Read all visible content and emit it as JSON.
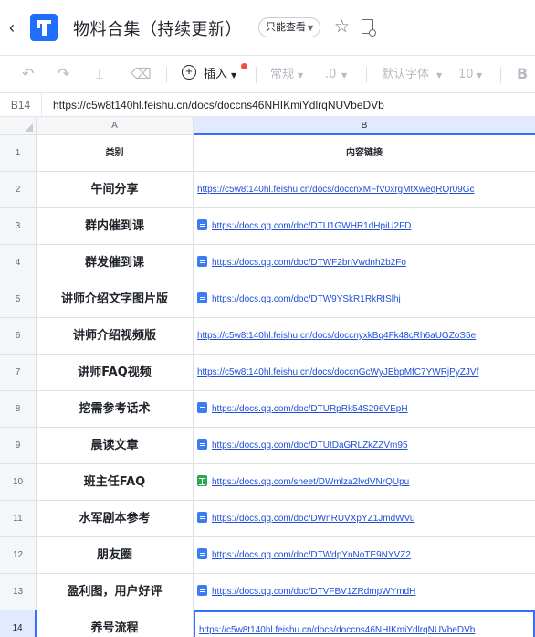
{
  "app": {
    "doc_title": "物料合集（持续更新）",
    "permission_label": "只能查看",
    "back_glyph": "‹",
    "star_glyph": "☆"
  },
  "toolbar": {
    "undo": "↶",
    "redo": "↷",
    "format_painter": "⌶",
    "clear_format": "⌫",
    "insert_label": "插入",
    "number_format": "常规",
    "decimal": ".0",
    "font_family": "默认字体",
    "font_size": "10",
    "bold": "B"
  },
  "formula_bar": {
    "cell_ref": "B14",
    "value": "https://c5w8t140hl.feishu.cn/docs/doccns46NHIKmiYdlrqNUVbeDVb"
  },
  "columns": [
    "A",
    "B"
  ],
  "rows": [
    {
      "num": "1",
      "category": "类别",
      "link": "内容链接",
      "icon": "none",
      "header": true
    },
    {
      "num": "2",
      "category": "午间分享",
      "link": "https://c5w8t140hl.feishu.cn/docs/doccnxMFfV0xrgMtXweqRQr09Gc",
      "icon": "none"
    },
    {
      "num": "3",
      "category": "群内催到课",
      "link": "https://docs.qq.com/doc/DTU1GWHR1dHpiU2FD",
      "icon": "doc"
    },
    {
      "num": "4",
      "category": "群发催到课",
      "link": "https://docs.qq.com/doc/DTWF2bnVwdnh2b2Fo",
      "icon": "doc"
    },
    {
      "num": "5",
      "category": "讲师介绍文字图片版",
      "link": "https://docs.qq.com/doc/DTW9YSkR1RkRISlhj",
      "icon": "doc"
    },
    {
      "num": "6",
      "category": "讲师介绍视频版",
      "link": "https://c5w8t140hl.feishu.cn/docs/doccnyxkBq4Fk48cRh6aUGZoS5e",
      "icon": "none"
    },
    {
      "num": "7",
      "category": "讲师FAQ视频",
      "link": "https://c5w8t140hl.feishu.cn/docs/doccnGcWyJEbpMfC7YWRjPyZJVf",
      "icon": "none"
    },
    {
      "num": "8",
      "category": "挖需参考话术",
      "link": "https://docs.qq.com/doc/DTURpRk54S296VEpH",
      "icon": "doc"
    },
    {
      "num": "9",
      "category": "晨读文章",
      "link": "https://docs.qq.com/doc/DTUtDaGRLZkZZVm95",
      "icon": "doc"
    },
    {
      "num": "10",
      "category": "班主任FAQ",
      "link": "https://docs.qq.com/sheet/DWmlza2lvdVNrQUpu",
      "icon": "sheet"
    },
    {
      "num": "11",
      "category": "水军剧本参考",
      "link": "https://docs.qq.com/doc/DWnRUVXpYZ1JmdWVu",
      "icon": "doc"
    },
    {
      "num": "12",
      "category": "朋友圈",
      "link": "https://docs.qq.com/doc/DTWdpYnNoTE9NYVZ2",
      "icon": "doc"
    },
    {
      "num": "13",
      "category": "盈利图，用户好评",
      "link": "https://docs.qq.com/doc/DTVFBV1ZRdmpWYmdH",
      "icon": "doc"
    },
    {
      "num": "14",
      "category": "养号流程",
      "link": "https://c5w8t140hl.feishu.cn/docs/doccns46NHIKmiYdlrqNUVbeDVb",
      "icon": "none",
      "active": true
    }
  ],
  "colors": {
    "accent": "#3370ff",
    "link": "#1f4fd8",
    "logo": "#1f6fff",
    "doc_icon": "#3b7cf5",
    "sheet_icon": "#2ea552",
    "notification_dot": "#f54a45"
  }
}
